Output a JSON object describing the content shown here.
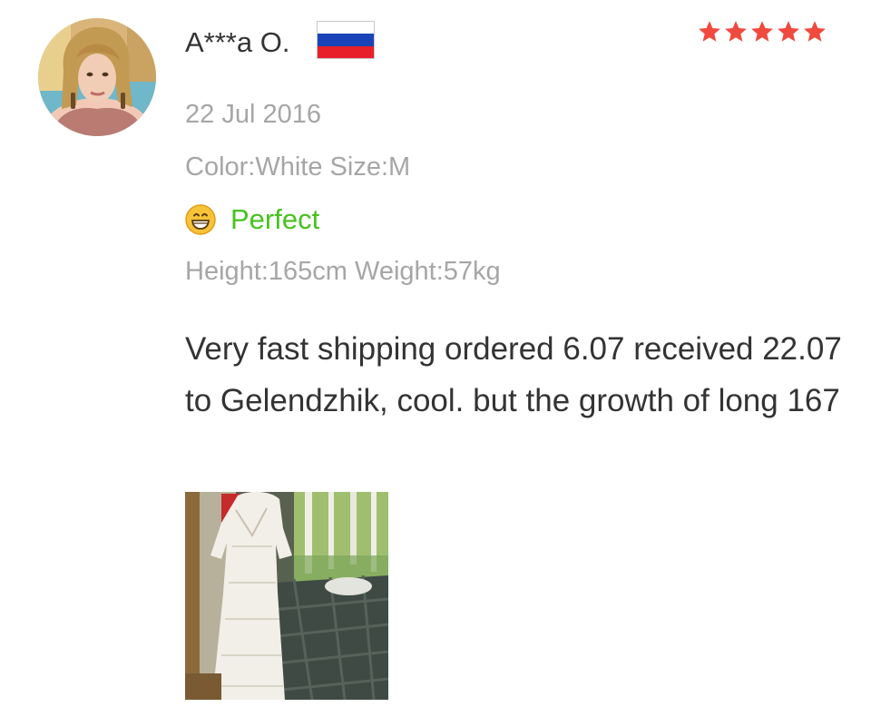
{
  "review": {
    "reviewer_name": "A***a O.",
    "country_flag": "russia-flag-icon",
    "rating": 5,
    "rating_max": 5,
    "date": "22 Jul 2016",
    "variant": "Color:White Size:M",
    "feeling_icon": "grinning-face-icon",
    "feeling": "Perfect",
    "body_info": "Height:165cm Weight:57kg",
    "text": "Very fast shipping ordered 6.07 received 22.07 to Gelendzhik, cool. but the growth of long 167"
  },
  "colors": {
    "star": "#f0493d",
    "feeling_text": "#47c21f",
    "primary_text": "#333333",
    "secondary_text": "#a6a6a6",
    "flag_white": "#ffffff",
    "flag_blue": "#1a44b8",
    "flag_red": "#e8202a"
  }
}
